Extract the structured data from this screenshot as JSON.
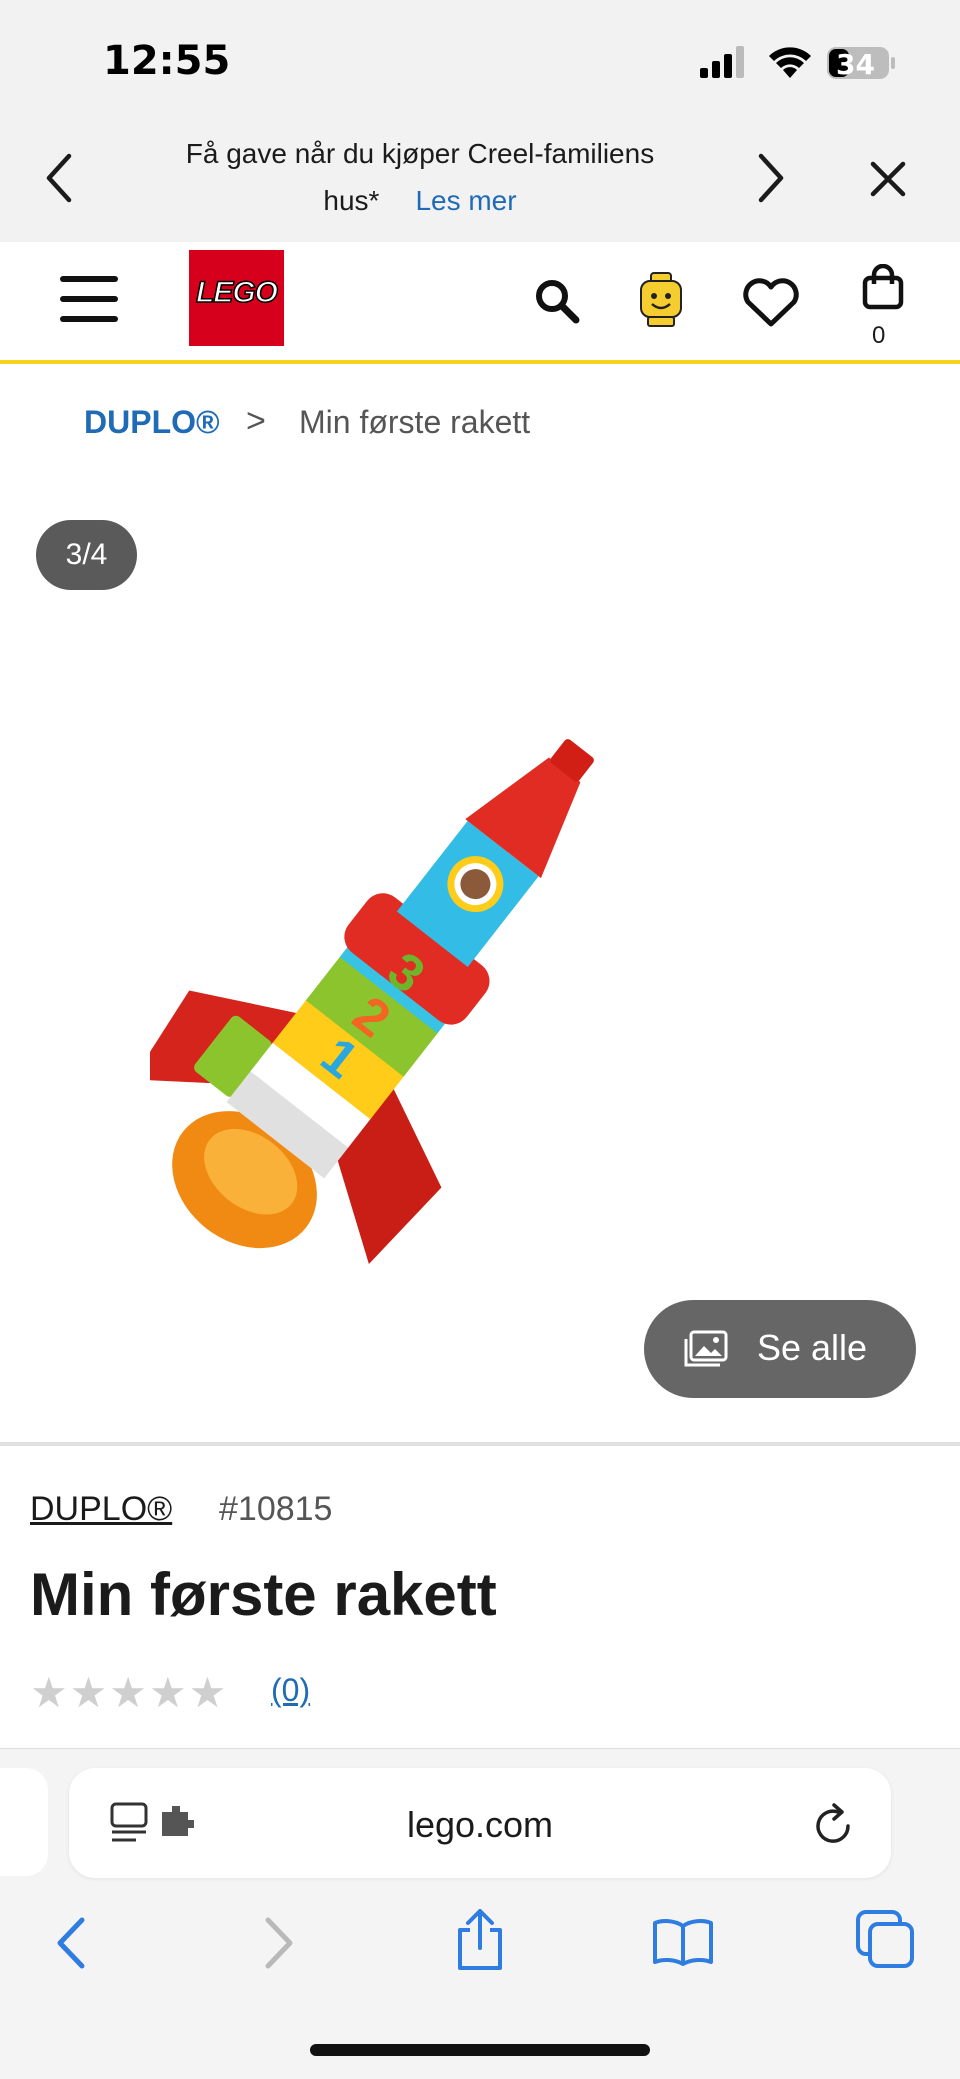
{
  "status_bar": {
    "time": "12:55",
    "battery": "34"
  },
  "promo": {
    "text": "Få gave når du kjøper Creel-familiens hus*",
    "link": "Les mer"
  },
  "header": {
    "logo_text": "LEGO",
    "cart_count": "0"
  },
  "breadcrumb": {
    "parent": "DUPLO®",
    "separator": ">",
    "current": "Min første rakett"
  },
  "gallery": {
    "counter": "3/4",
    "see_all": "Se alle"
  },
  "product": {
    "theme": "DUPLO®",
    "item_number": "#10815",
    "title": "Min første rakett",
    "rating_count": "(0)",
    "stars": "★★★★★"
  },
  "browser": {
    "url": "lego.com"
  },
  "colors": {
    "lego_red": "#d6001c",
    "header_yellow": "#f6d21b",
    "link_blue": "#1f6bb5",
    "ios_blue": "#2f7de1"
  },
  "icons": [
    "back-chevron-icon",
    "forward-chevron-icon",
    "close-icon",
    "menu-icon",
    "search-icon",
    "minifig-icon",
    "heart-icon",
    "bag-icon",
    "gallery-icon",
    "reader-icon",
    "reload-icon",
    "share-icon",
    "bookmarks-icon",
    "tabs-icon"
  ]
}
